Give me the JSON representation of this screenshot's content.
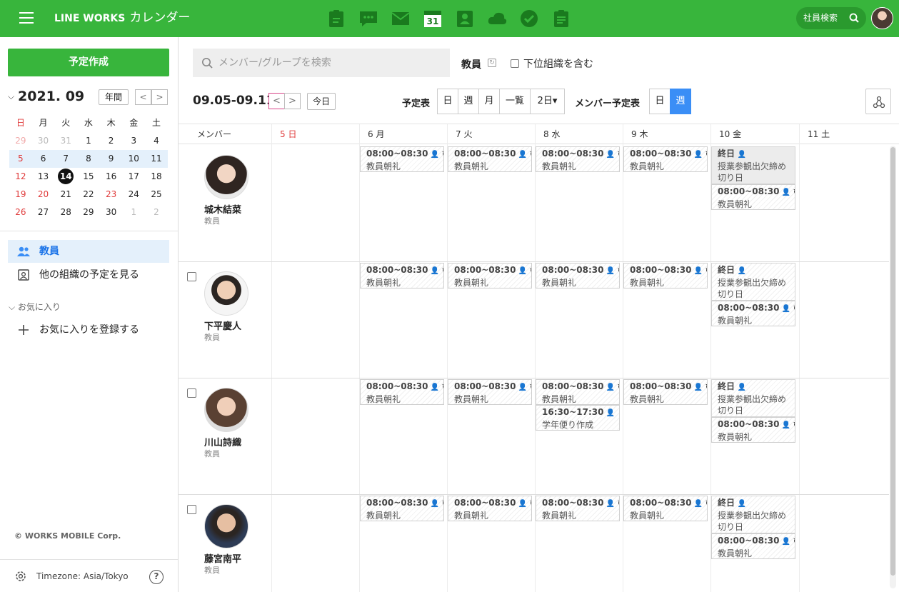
{
  "header": {
    "brand": "LINE WORKS",
    "app_name": "カレンダー",
    "search_label": "社員検索",
    "apps": [
      "approval-icon",
      "talk-icon",
      "mail-icon",
      "calendar-icon",
      "contacts-icon",
      "drive-icon",
      "task-icon",
      "form-icon"
    ],
    "calendar_icon_day": "31",
    "accent_color": "#38b53c"
  },
  "sidebar": {
    "create_label": "予定作成",
    "mini_title": "2021. 09",
    "year_button": "年間",
    "prev": "<",
    "next": ">",
    "weekdays": [
      "日",
      "月",
      "火",
      "水",
      "木",
      "金",
      "土"
    ],
    "weeks": [
      [
        "29",
        "30",
        "31",
        "1",
        "2",
        "3",
        "4"
      ],
      [
        "5",
        "6",
        "7",
        "8",
        "9",
        "10",
        "11"
      ],
      [
        "12",
        "13",
        "14",
        "15",
        "16",
        "17",
        "18"
      ],
      [
        "19",
        "20",
        "21",
        "22",
        "23",
        "24",
        "25"
      ],
      [
        "26",
        "27",
        "28",
        "29",
        "30",
        "1",
        "2"
      ]
    ],
    "selected_week_index": 1,
    "today": "14",
    "items": [
      {
        "label": "教員",
        "icon": "group-icon"
      },
      {
        "label": "他の組織の予定を見る",
        "icon": "org-calendar-icon"
      }
    ],
    "favorites_label": "お気に入り",
    "add_favorite": "お気に入りを登録する",
    "copyright": "© WORKS MOBILE Corp.",
    "timezone": "Timezone: Asia/Tokyo",
    "help": "?"
  },
  "toolbar": {
    "search_placeholder": "メンバー/グループを検索",
    "group_label": "教員",
    "include_sub": "下位組織を含む",
    "range": "09.05-09.11",
    "today_label": "今日",
    "schedule_label": "予定表",
    "views": [
      "日",
      "週",
      "月",
      "一覧",
      "2日▾"
    ],
    "member_label": "メンバー予定表",
    "member_views": [
      "日",
      "週"
    ],
    "active_member_view": "週"
  },
  "grid": {
    "member_header": "メンバー",
    "days": [
      "5 日",
      "6 月",
      "7 火",
      "8 水",
      "9 木",
      "10 金",
      "11 土"
    ],
    "members": [
      {
        "name": "城木結菜",
        "role": "教員",
        "checkbox": false,
        "events": [
          {
            "day": 1,
            "time": "08:00~08:30",
            "title": "教員朝礼"
          },
          {
            "day": 2,
            "time": "08:00~08:30",
            "title": "教員朝礼"
          },
          {
            "day": 3,
            "time": "08:00~08:30",
            "title": "教員朝礼"
          },
          {
            "day": 4,
            "time": "08:00~08:30",
            "title": "教員朝礼"
          },
          {
            "day": 5,
            "time": "終日",
            "title": "授業参観出欠締め切り日",
            "allday": true
          },
          {
            "day": 5,
            "time": "08:00~08:30",
            "title": "教員朝礼",
            "slot": 2
          }
        ]
      },
      {
        "name": "下平慶人",
        "role": "教員",
        "checkbox": true,
        "events": [
          {
            "day": 1,
            "time": "08:00~08:30",
            "title": "教員朝礼"
          },
          {
            "day": 2,
            "time": "08:00~08:30",
            "title": "教員朝礼"
          },
          {
            "day": 3,
            "time": "08:00~08:30",
            "title": "教員朝礼"
          },
          {
            "day": 4,
            "time": "08:00~08:30",
            "title": "教員朝礼"
          },
          {
            "day": 5,
            "time": "終日",
            "title": "授業参観出欠締め切り日",
            "allday": true
          },
          {
            "day": 5,
            "time": "08:00~08:30",
            "title": "教員朝礼",
            "slot": 2
          }
        ]
      },
      {
        "name": "川山詩織",
        "role": "教員",
        "checkbox": true,
        "events": [
          {
            "day": 1,
            "time": "08:00~08:30",
            "title": "教員朝礼"
          },
          {
            "day": 2,
            "time": "08:00~08:30",
            "title": "教員朝礼"
          },
          {
            "day": 3,
            "time": "08:00~08:30",
            "title": "教員朝礼"
          },
          {
            "day": 3,
            "time": "16:30~17:30",
            "title": "学年便り作成",
            "slot": 2
          },
          {
            "day": 4,
            "time": "08:00~08:30",
            "title": "教員朝礼"
          },
          {
            "day": 5,
            "time": "終日",
            "title": "授業参観出欠締め切り日",
            "allday": true
          },
          {
            "day": 5,
            "time": "08:00~08:30",
            "title": "教員朝礼",
            "slot": 2
          }
        ]
      },
      {
        "name": "藤宮南平",
        "role": "教員",
        "checkbox": true,
        "events": [
          {
            "day": 1,
            "time": "08:00~08:30",
            "title": "教員朝礼"
          },
          {
            "day": 2,
            "time": "08:00~08:30",
            "title": "教員朝礼"
          },
          {
            "day": 3,
            "time": "08:00~08:30",
            "title": "教員朝礼"
          },
          {
            "day": 4,
            "time": "08:00~08:30",
            "title": "教員朝礼"
          },
          {
            "day": 5,
            "time": "終日",
            "title": "授業参観出欠締め切り日",
            "allday": true
          },
          {
            "day": 5,
            "time": "08:00~08:30",
            "title": "教員朝礼",
            "slot": 2
          }
        ]
      }
    ]
  }
}
